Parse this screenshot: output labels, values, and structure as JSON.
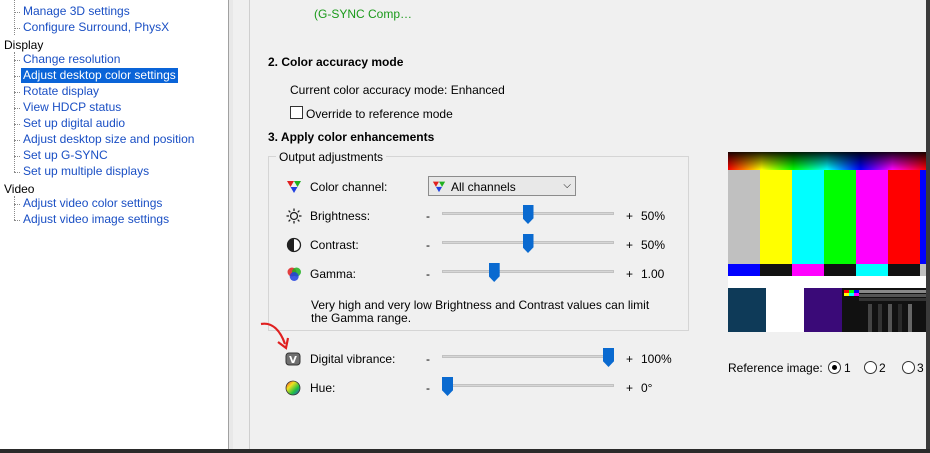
{
  "tree": {
    "items_top": [
      {
        "label": "Manage 3D settings"
      },
      {
        "label": "Configure Surround, PhysX"
      }
    ],
    "display_group": "Display",
    "display_items": [
      {
        "label": "Change resolution"
      },
      {
        "label": "Adjust desktop color settings"
      },
      {
        "label": "Rotate display"
      },
      {
        "label": "View HDCP status"
      },
      {
        "label": "Set up digital audio"
      },
      {
        "label": "Adjust desktop size and position"
      },
      {
        "label": "Set up G-SYNC"
      },
      {
        "label": "Set up multiple displays"
      }
    ],
    "video_group": "Video",
    "video_items": [
      {
        "label": "Adjust video color settings"
      },
      {
        "label": "Adjust video image settings"
      }
    ]
  },
  "displays": {
    "monitor1_sub": "(G-SYNC Comp…"
  },
  "section2": {
    "title": "2. Color accuracy mode",
    "current_mode": "Current color accuracy mode: Enhanced",
    "override_label": "Override to reference mode",
    "override_checked": false
  },
  "section3": {
    "title": "3. Apply color enhancements",
    "group_title": "Output adjustments",
    "color_channel_label": "Color channel:",
    "color_channel_value": "All channels",
    "brightness_label": "Brightness:",
    "brightness_value": "50%",
    "brightness_level": 0.5,
    "contrast_label": "Contrast:",
    "contrast_value": "50%",
    "contrast_level": 0.5,
    "gamma_label": "Gamma:",
    "gamma_value": "1.00",
    "gamma_level": 0.29,
    "note": "Very high and very low Brightness and Contrast values can limit",
    "note2": "the Gamma range.",
    "vibrance_label": "Digital vibrance:",
    "vibrance_value": "100%",
    "vibrance_level": 1.0,
    "hue_label": "Hue:",
    "hue_value": "0°",
    "hue_level": 0.0,
    "minus": "-",
    "plus": "+"
  },
  "reference": {
    "label": "Reference image:",
    "options": [
      "1",
      "2",
      "3"
    ],
    "selected": "1"
  },
  "colors": {
    "accent": "#0a6ad0",
    "tree_link": "#1a4fc4",
    "selected_bg": "#0a64d8",
    "annotation_arrow": "#e02020"
  }
}
